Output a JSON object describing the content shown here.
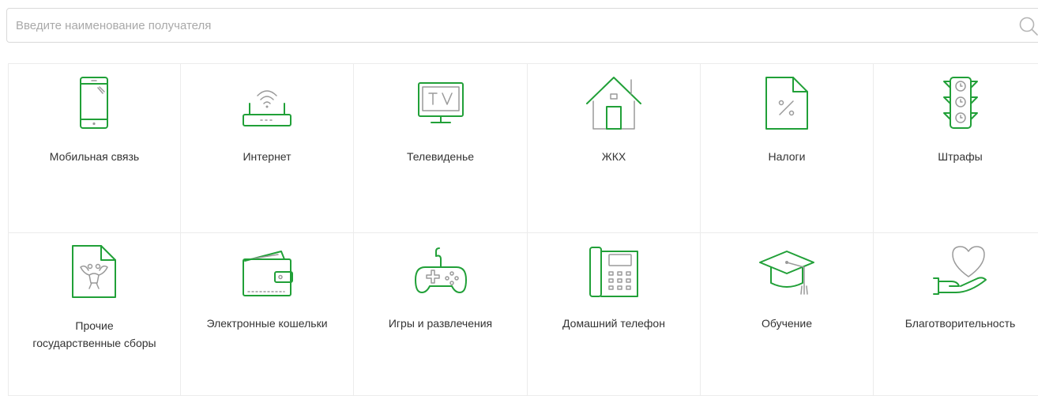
{
  "search": {
    "placeholder": "Введите наименование получателя",
    "value": ""
  },
  "categories": [
    {
      "label": "Мобильная связь",
      "icon": "mobile-phone-icon"
    },
    {
      "label": "Интернет",
      "icon": "wifi-router-icon"
    },
    {
      "label": "Телевиденье",
      "icon": "tv-icon"
    },
    {
      "label": "ЖКХ",
      "icon": "house-icon"
    },
    {
      "label": "Налоги",
      "icon": "tax-document-icon"
    },
    {
      "label": "Штрафы",
      "icon": "traffic-light-icon"
    },
    {
      "label_line1": "Прочие",
      "label_line2": "государственные сборы",
      "icon": "emblem-document-icon"
    },
    {
      "label": "Электронные кошельки",
      "icon": "wallet-icon"
    },
    {
      "label": "Игры и развлечения",
      "icon": "gamepad-icon"
    },
    {
      "label": "Домашний телефон",
      "icon": "desk-phone-icon"
    },
    {
      "label": "Обучение",
      "icon": "graduation-cap-icon"
    },
    {
      "label": "Благотворительность",
      "icon": "heart-hand-icon"
    }
  ],
  "colors": {
    "accent": "#21a038",
    "icon_gray": "#9a9a9a",
    "border": "#ececec",
    "text": "#333333",
    "placeholder": "#a9a9a9"
  }
}
